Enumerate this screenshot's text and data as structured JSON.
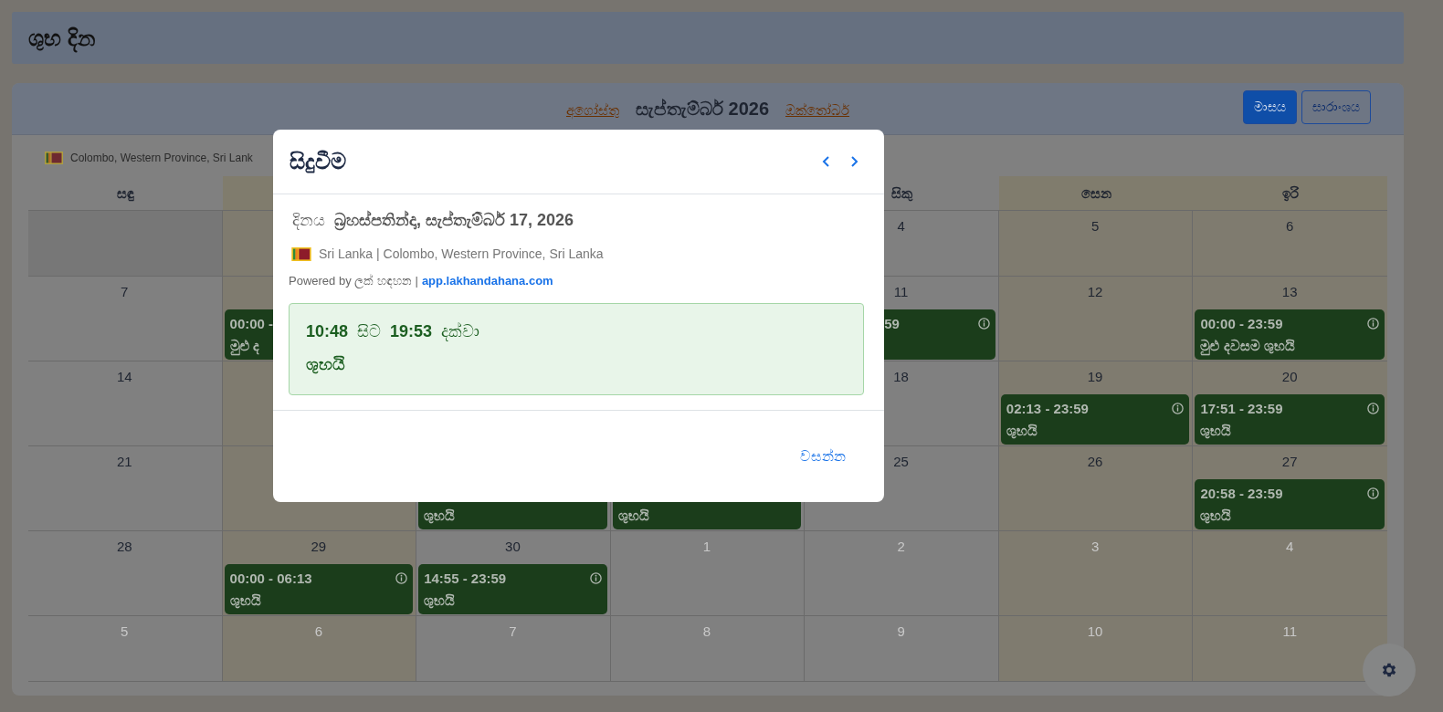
{
  "header": {
    "title": "ශුභ දින"
  },
  "calendar": {
    "nav": {
      "prev": "අගෝස්තු",
      "current": "සැප්තැම්බර් 2026",
      "next": "ඔක්තෝබර්"
    },
    "views": [
      {
        "label": "මාසය",
        "selected": true
      },
      {
        "label": "සාරාංශය",
        "selected": false
      }
    ],
    "location": "Colombo, Western Province, Sri Lank",
    "columns": [
      {
        "label": "සඳු",
        "shaded": false
      },
      {
        "shaded": true
      },
      {},
      {},
      {
        "label": "සිකු",
        "shaded": false
      },
      {
        "label": "සෙන",
        "shaded": true
      },
      {
        "label": "ඉරි",
        "shaded": true
      }
    ],
    "weeks": [
      {
        "cells": [
          {
            "kind": "empty"
          },
          {
            "kind": "day"
          },
          {
            "kind": "day"
          },
          {
            "kind": "day"
          },
          {
            "kind": "day",
            "day": "4",
            "in_month": true
          },
          {
            "kind": "day",
            "day": "5",
            "in_month": true
          },
          {
            "kind": "day",
            "day": "6",
            "in_month": true
          }
        ]
      },
      {
        "cells": [
          {
            "kind": "day",
            "day": "7",
            "in_month": true
          },
          {
            "kind": "day",
            "events": [
              {
                "time": "00:00 -",
                "title": "මුළු ද",
                "info": false
              }
            ]
          },
          {
            "kind": "day"
          },
          {
            "kind": "day"
          },
          {
            "kind": "day",
            "day": "11",
            "in_month": true,
            "events": [
              {
                "time": "59",
                "info": true
              }
            ]
          },
          {
            "kind": "day",
            "day": "12",
            "in_month": true
          },
          {
            "kind": "day",
            "day": "13",
            "in_month": true,
            "events": [
              {
                "time": "00:00 - 23:59",
                "title": "මුළු දවසම ශුභයි",
                "info": true
              }
            ]
          }
        ]
      },
      {
        "cells": [
          {
            "kind": "day",
            "day": "14",
            "in_month": true
          },
          {
            "kind": "day"
          },
          {
            "kind": "day"
          },
          {
            "kind": "day"
          },
          {
            "kind": "day",
            "day": "18",
            "in_month": true
          },
          {
            "kind": "day",
            "day": "19",
            "in_month": true,
            "events": [
              {
                "time": "02:13 - 23:59",
                "title": "ශුභයි",
                "info": true
              }
            ]
          },
          {
            "kind": "day",
            "day": "20",
            "in_month": true,
            "events": [
              {
                "time": "17:51 - 23:59",
                "title": "ශුභයි",
                "info": true
              }
            ]
          }
        ]
      },
      {
        "cells": [
          {
            "kind": "day",
            "day": "21",
            "in_month": true
          },
          {
            "kind": "day"
          },
          {
            "kind": "day",
            "events": [
              {
                "title": "ශුභයි",
                "info": false
              }
            ]
          },
          {
            "kind": "day",
            "events": [
              {
                "title": "ශුභයි",
                "info": false
              }
            ]
          },
          {
            "kind": "day",
            "day": "25",
            "in_month": true
          },
          {
            "kind": "day",
            "day": "26",
            "in_month": true
          },
          {
            "kind": "day",
            "day": "27",
            "in_month": true,
            "events": [
              {
                "time": "20:58 - 23:59",
                "title": "ශුභයි",
                "info": true
              }
            ]
          }
        ]
      },
      {
        "cells": [
          {
            "kind": "day",
            "day": "28",
            "in_month": true
          },
          {
            "kind": "day",
            "day": "29",
            "in_month": true,
            "events": [
              {
                "time": "00:00 - 06:13",
                "title": "ශුභයි",
                "info": true
              }
            ]
          },
          {
            "kind": "day",
            "day": "30",
            "in_month": true,
            "events": [
              {
                "time": "14:55 - 23:59",
                "title": "ශුභයි",
                "info": true
              }
            ]
          },
          {
            "kind": "day",
            "day": "1",
            "in_month": false
          },
          {
            "kind": "day",
            "day": "2",
            "in_month": false
          },
          {
            "kind": "day",
            "day": "3",
            "in_month": false
          },
          {
            "kind": "day",
            "day": "4",
            "in_month": false
          }
        ]
      },
      {
        "cells": [
          {
            "kind": "day",
            "day": "5",
            "in_month": false
          },
          {
            "kind": "day",
            "day": "6",
            "in_month": false
          },
          {
            "kind": "day",
            "day": "7",
            "in_month": false
          },
          {
            "kind": "day",
            "day": "8",
            "in_month": false
          },
          {
            "kind": "day",
            "day": "9",
            "in_month": false
          },
          {
            "kind": "day",
            "day": "10",
            "in_month": false
          },
          {
            "kind": "day",
            "day": "11",
            "in_month": false
          }
        ]
      }
    ]
  },
  "dialog": {
    "title": "සිදුවීම",
    "date_label": "දිනය",
    "date": "බ්‍රහස්පතින්දා, සැප්තැම්බර් 17, 2026",
    "location": "Sri Lanka | Colombo, Western Province, Sri Lanka",
    "powered_by": "Powered by ලක් හඳහන |",
    "link": "app.lakhandahana.com",
    "event": {
      "start": "10:48",
      "from_word": "සිට",
      "end": "19:53",
      "to_word": "දක්වා",
      "title": "ශුභයි"
    },
    "close": "වසන්න"
  }
}
